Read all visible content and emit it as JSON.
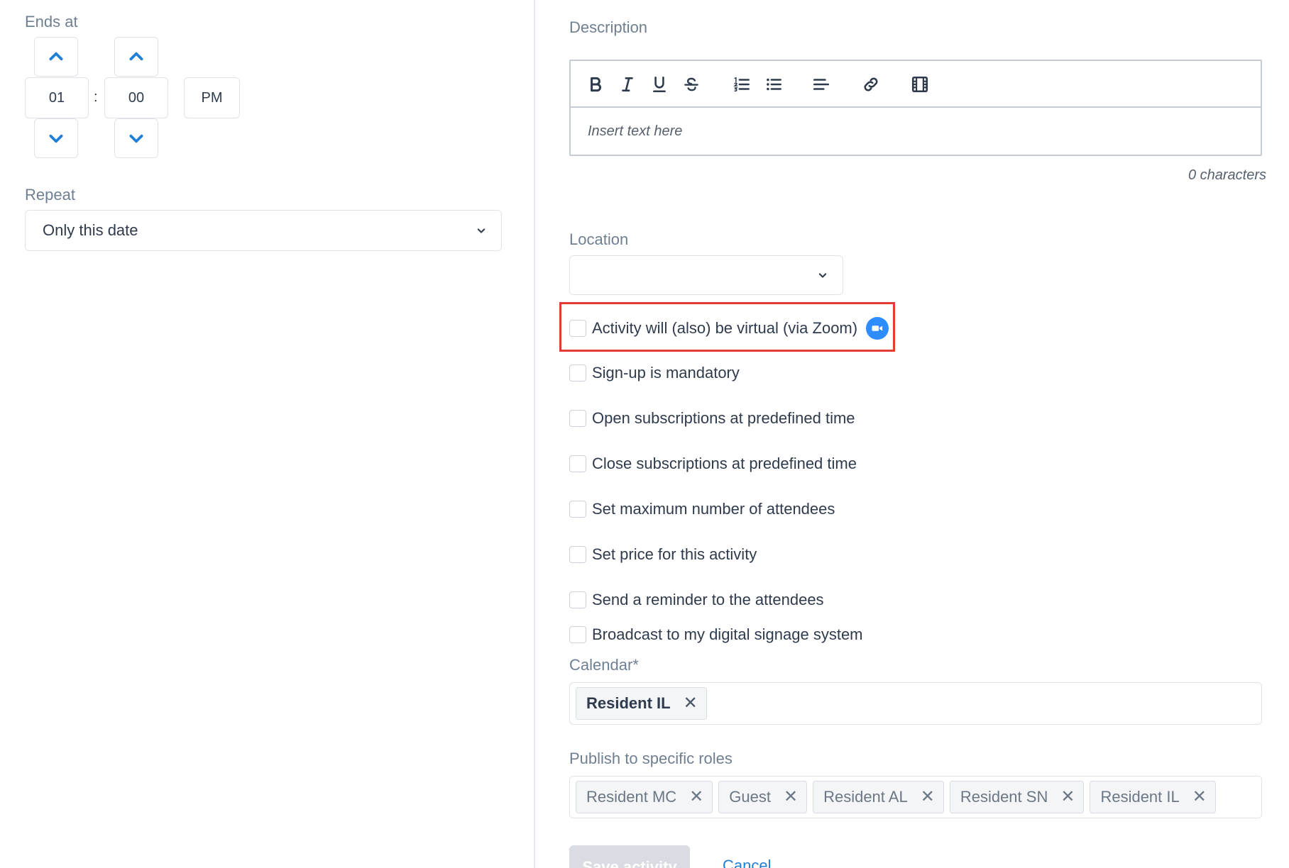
{
  "ends_at": {
    "label": "Ends at",
    "hour": "01",
    "separator": ":",
    "minute": "00",
    "period": "PM"
  },
  "repeat": {
    "label": "Repeat",
    "value": "Only this date"
  },
  "description": {
    "label": "Description",
    "placeholder": "Insert text here",
    "char_count": "0 characters"
  },
  "location": {
    "label": "Location",
    "value": ""
  },
  "options": [
    {
      "label": "Activity will (also) be virtual (via Zoom)",
      "checked": false
    },
    {
      "label": "Sign-up is mandatory",
      "checked": false
    },
    {
      "label": "Open subscriptions at predefined time",
      "checked": false
    },
    {
      "label": "Close subscriptions at predefined time",
      "checked": false
    },
    {
      "label": "Set maximum number of attendees",
      "checked": false
    },
    {
      "label": "Set price for this activity",
      "checked": false
    },
    {
      "label": "Send a reminder to the attendees",
      "checked": false
    },
    {
      "label": "Broadcast to my digital signage system",
      "checked": false
    }
  ],
  "calendar": {
    "label": "Calendar*",
    "tags": [
      "Resident IL"
    ]
  },
  "roles": {
    "label": "Publish to specific roles",
    "tags": [
      "Resident MC",
      "Guest",
      "Resident AL",
      "Resident SN",
      "Resident IL"
    ]
  },
  "actions": {
    "save": "Save activity",
    "cancel": "Cancel"
  },
  "colors": {
    "accent": "#1f7fd6",
    "zoom": "#2d8cff",
    "highlight": "#e53935"
  }
}
